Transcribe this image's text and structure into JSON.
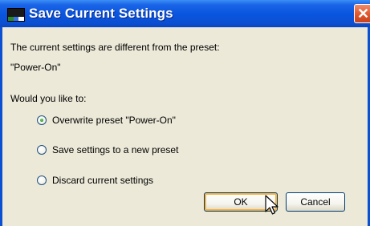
{
  "window": {
    "title": "Save Current Settings",
    "close_glyph": "✕",
    "app_icon": "window-app-icon"
  },
  "message": {
    "line1": "The current settings are different from the preset:",
    "line2": "\"Power-On\""
  },
  "question": "Would you like to:",
  "options": [
    {
      "label": "Overwrite preset \"Power-On\"",
      "checked": true
    },
    {
      "label": "Save settings to a new preset",
      "checked": false
    },
    {
      "label": "Discard current settings",
      "checked": false
    }
  ],
  "buttons": {
    "ok": "OK",
    "cancel": "Cancel"
  },
  "colors": {
    "titlebar": "#0b4fd2",
    "dialog_bg": "#ece9d8",
    "close_button": "#e25a2f",
    "default_button_focus": "#f8b23c"
  }
}
